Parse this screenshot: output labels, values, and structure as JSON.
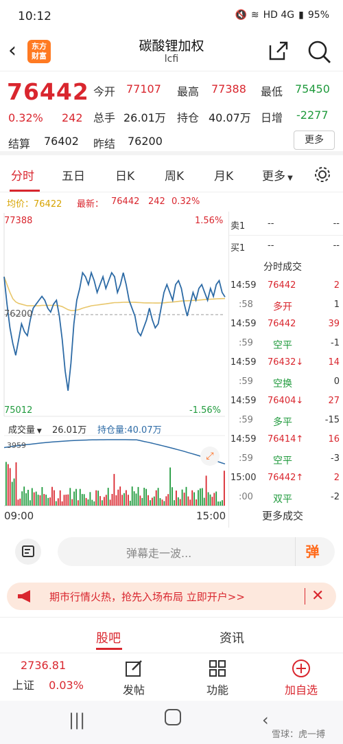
{
  "status": {
    "time": "10:12",
    "battery": "95%",
    "network": "HD 4G"
  },
  "header": {
    "logo_text": "东方\n财富",
    "title": "碳酸锂加权",
    "code": "lcfi"
  },
  "quote": {
    "price": "76442",
    "change_pct": "0.32%",
    "change": "242",
    "labels": {
      "open": "今开",
      "high": "最高",
      "low": "最低",
      "turnover": "总手",
      "position": "持仓",
      "daily_inc": "日增",
      "settle": "结算",
      "prev_settle": "昨结"
    },
    "open": "77107",
    "high": "77388",
    "low": "75450",
    "turnover": "26.01万",
    "position": "40.07万",
    "daily_inc": "-2277",
    "settle": "76402",
    "prev_settle": "76200",
    "more": "更多"
  },
  "tabs": [
    "分时",
    "五日",
    "日K",
    "周K",
    "月K",
    "更多"
  ],
  "infoline": {
    "avg_label": "均价：76422",
    "latest_label": "最新：",
    "latest": "76442",
    "chg": "242",
    "pct": "0.32%"
  },
  "chart_data": {
    "type": "line",
    "y_max": "77388",
    "y_min": "75012",
    "y_mid": "76200",
    "pct_max": "1.56%",
    "pct_min": "-1.56%",
    "x_start": "09:00",
    "x_end": "15:00",
    "price_series": [
      76700,
      76350,
      76050,
      75850,
      75700,
      75900,
      76100,
      76000,
      75950,
      76150,
      76300,
      76350,
      76400,
      76450,
      76400,
      76300,
      76250,
      76350,
      76400,
      76200,
      75900,
      75500,
      75250,
      75600,
      76100,
      76400,
      76550,
      76750,
      76700,
      76600,
      76750,
      76650,
      76500,
      76600,
      76700,
      76550,
      76650,
      76750,
      76700,
      76500,
      76600,
      76750,
      76600,
      76400,
      76300,
      76200,
      76000,
      75950,
      76050,
      76150,
      76300,
      76150,
      76050,
      76100,
      76300,
      76500,
      76600,
      76500,
      76400,
      76600,
      76650,
      76550,
      76350,
      76200,
      76350,
      76500,
      76400,
      76550,
      76600,
      76500,
      76400,
      76550,
      76450,
      76600,
      76650,
      76500,
      76442
    ],
    "avg_series": [
      76700,
      76600,
      76500,
      76420,
      76380,
      76360,
      76350,
      76340,
      76330,
      76330,
      76330,
      76330,
      76330,
      76335,
      76335,
      76335,
      76335,
      76335,
      76335,
      76330,
      76320,
      76300,
      76280,
      76270,
      76270,
      76275,
      76285,
      76300,
      76310,
      76320,
      76330,
      76335,
      76340,
      76345,
      76350,
      76355,
      76360,
      76365,
      76370,
      76370,
      76372,
      76375,
      76376,
      76376,
      76375,
      76374,
      76372,
      76370,
      76368,
      76367,
      76367,
      76366,
      76365,
      76365,
      76366,
      76368,
      76372,
      76375,
      76378,
      76382,
      76386,
      76390,
      76392,
      76394,
      76396,
      76398,
      76400,
      76403,
      76406,
      76409,
      76412,
      76414,
      76416,
      76418,
      76420,
      76421,
      76422
    ],
    "volume_label": "成交量",
    "volume": "26.01万",
    "position_label": "持仓量:40.07万",
    "volume_max": "3959"
  },
  "panel": {
    "sell1_label": "卖1",
    "sell1_price": "--",
    "sell1_vol": "--",
    "buy1_label": "买1",
    "buy1_price": "--",
    "buy1_vol": "--",
    "ticks_title": "分时成交",
    "ticks": [
      {
        "time": "14:59",
        "price": "76442",
        "vol": "2",
        "sub": ":58",
        "type": "多开",
        "type_vol": "1"
      },
      {
        "time": "14:59",
        "price": "76442",
        "vol": "39",
        "sub": ":59",
        "type": "空平",
        "type_vol": "-1"
      },
      {
        "time": "14:59",
        "price": "76432↓",
        "vol": "14",
        "sub": ":59",
        "type": "空换",
        "type_vol": "0"
      },
      {
        "time": "14:59",
        "price": "76404↓",
        "vol": "27",
        "sub": ":59",
        "type": "多平",
        "type_vol": "-15"
      },
      {
        "time": "14:59",
        "price": "76414↑",
        "vol": "16",
        "sub": ":59",
        "type": "空平",
        "type_vol": "-3"
      },
      {
        "time": "15:00",
        "price": "76442↑",
        "vol": "2",
        "sub": ":00",
        "type": "双平",
        "type_vol": "-2"
      }
    ],
    "more_ticks": "更多成交"
  },
  "comment": {
    "placeholder": "弹幕走一波...",
    "button": "弹"
  },
  "banner": {
    "text": "期市行情火热，抢先入场布局 立即开户>>"
  },
  "sections": [
    "股吧",
    "资讯"
  ],
  "bottom_nav": {
    "index_value": "2736.81",
    "index_name": "上证",
    "index_pct": "0.03%",
    "post": "发帖",
    "features": "功能",
    "add_fav": "加自选"
  },
  "watermark": "雪球：虎一搏"
}
